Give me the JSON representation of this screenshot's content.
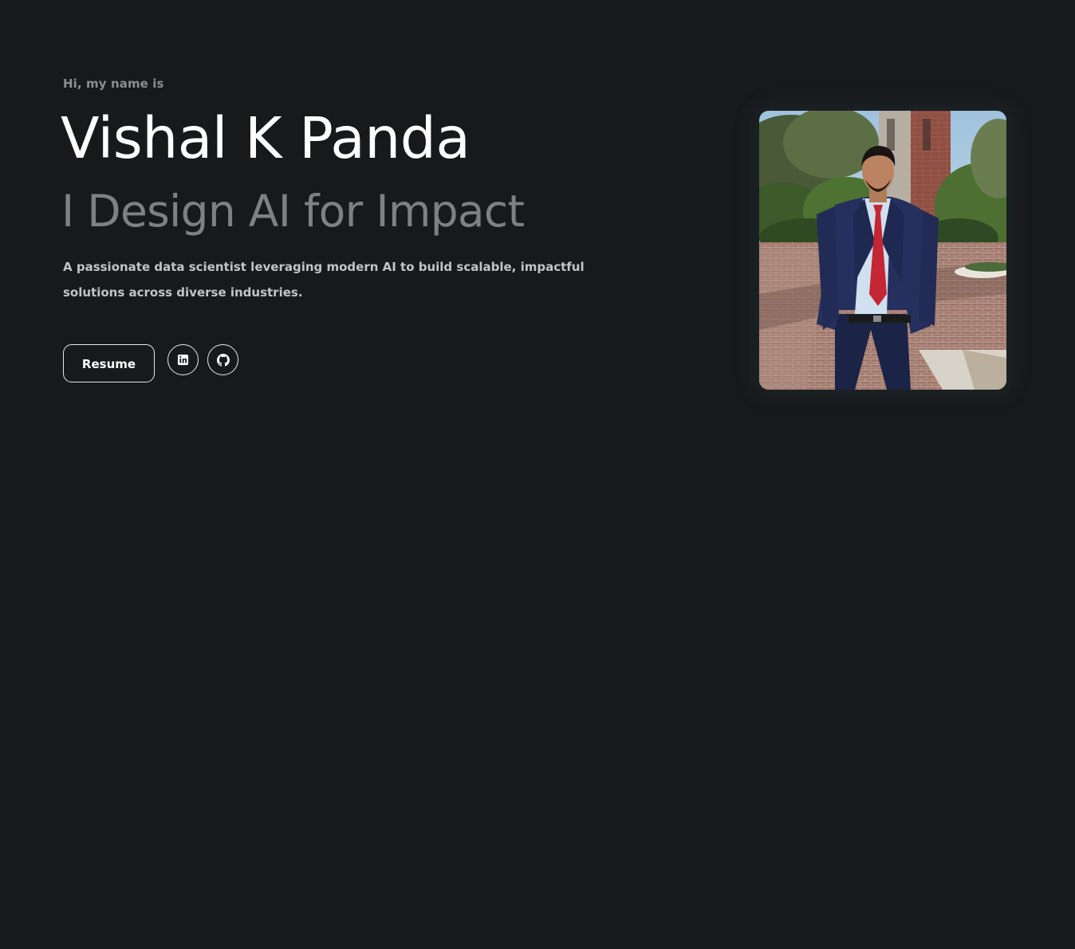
{
  "hero": {
    "intro": "Hi, my name is",
    "name": "Vishal K Panda",
    "tagline": "I Design AI for Impact",
    "description": "A passionate data scientist leveraging modern AI to build scalable, impactful solutions across diverse industries."
  },
  "actions": {
    "resume_label": "Resume",
    "social": [
      {
        "icon": "linkedin-icon"
      },
      {
        "icon": "github-icon"
      }
    ]
  },
  "portrait": {
    "alt": "Vishal K Panda standing in a navy suit and red tie on a brick plaza"
  },
  "colors": {
    "background": "#18191b",
    "name": "#ffffff",
    "tagline": "#7f8083",
    "intro": "#8c8d90",
    "description": "#c3c4c7",
    "border": "#e8e8ea"
  }
}
